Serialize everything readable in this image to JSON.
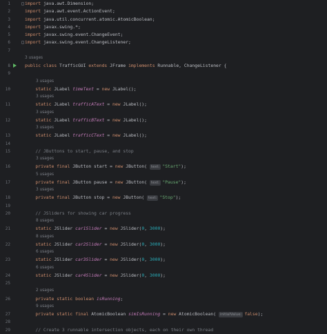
{
  "lines": [
    {
      "n": "1",
      "html": "<span class='kw'>import</span> java.awt.Dimension;"
    },
    {
      "n": "2",
      "html": "<span class='kw'>import</span> java.awt.event.ActionEvent;"
    },
    {
      "n": "3",
      "html": "<span class='kw'>import</span> java.util.concurrent.atomic.AtomicBoolean;"
    },
    {
      "n": "4",
      "html": "<span class='kw'>import</span> javax.swing.*;"
    },
    {
      "n": "5",
      "html": "<span class='kw'>import</span> javax.swing.event.ChangeEvent;"
    },
    {
      "n": "6",
      "html": "<span class='kw'>import</span> javax.swing.event.ChangeListener;"
    },
    {
      "n": "7",
      "html": ""
    },
    {
      "usage": "3 usages"
    },
    {
      "n": "8",
      "run": true,
      "html": "<span class='kw'>public class</span> TrafficGUI <span class='kw'>extends</span> JFrame <span class='kw'>implements</span> Runnable, ChangeListener {"
    },
    {
      "n": "9",
      "html": ""
    },
    {
      "usage": "3 usages"
    },
    {
      "n": "10",
      "html": "    <span class='kw'>static</span> JLabel <span class='field'>timeText</span> = <span class='kw'>new</span> JLabel();"
    },
    {
      "usage": "3 usages"
    },
    {
      "n": "11",
      "html": "    <span class='kw'>static</span> JLabel <span class='field'>trafficAText</span> = <span class='kw'>new</span> JLabel();"
    },
    {
      "usage": "3 usages"
    },
    {
      "n": "12",
      "html": "    <span class='kw'>static</span> JLabel <span class='field'>trafficBText</span> = <span class='kw'>new</span> JLabel();"
    },
    {
      "usage": "3 usages"
    },
    {
      "n": "13",
      "html": "    <span class='kw'>static</span> JLabel <span class='field'>trafficCText</span> = <span class='kw'>new</span> JLabel();"
    },
    {
      "n": "14",
      "html": ""
    },
    {
      "n": "15",
      "html": "    <span class='cm'>// JButtons to start, pause, and stop</span>"
    },
    {
      "usage": "3 usages"
    },
    {
      "n": "16",
      "html": "    <span class='kw'>private final</span> JButton start = <span class='kw'>new</span> JButton( <span class='hint'>text:</span><span class='str'>\"Start\"</span>);"
    },
    {
      "usage": "5 usages"
    },
    {
      "n": "17",
      "html": "    <span class='kw'>private final</span> JButton pause = <span class='kw'>new</span> JButton( <span class='hint'>text:</span><span class='str'>\"Pause\"</span>);"
    },
    {
      "usage": "3 usages"
    },
    {
      "n": "18",
      "html": "    <span class='kw'>private final</span> JButton stop = <span class='kw'>new</span> JButton( <span class='hint'>text:</span><span class='str'>\"Stop\"</span>);"
    },
    {
      "n": "19",
      "html": ""
    },
    {
      "n": "20",
      "html": "    <span class='cm'>// JSliders for showing car progress</span>"
    },
    {
      "usage": "8 usages"
    },
    {
      "n": "21",
      "html": "    <span class='kw'>static</span> JSlider <span class='field'>car1Slider</span> = <span class='kw'>new</span> JSlider(<span class='num-lit'>0</span>, <span class='num-lit'>3000</span>);"
    },
    {
      "usage": "8 usages"
    },
    {
      "n": "22",
      "html": "    <span class='kw'>static</span> JSlider <span class='field'>car2Slider</span> = <span class='kw'>new</span> JSlider(<span class='num-lit'>0</span>, <span class='num-lit'>3000</span>);"
    },
    {
      "usage": "6 usages"
    },
    {
      "n": "23",
      "html": "    <span class='kw'>static</span> JSlider <span class='field'>car3Slider</span> = <span class='kw'>new</span> JSlider(<span class='num-lit'>0</span>, <span class='num-lit'>3000</span>);"
    },
    {
      "usage": "6 usages"
    },
    {
      "n": "24",
      "html": "    <span class='kw'>static</span> JSlider <span class='field'>car4Slider</span> = <span class='kw'>new</span> JSlider(<span class='num-lit'>0</span>, <span class='num-lit'>3000</span>);"
    },
    {
      "n": "25",
      "html": ""
    },
    {
      "usage": "2 usages"
    },
    {
      "n": "26",
      "html": "    <span class='kw'>private static boolean</span> <span class='field'>isRunning</span>;"
    },
    {
      "usage": "9 usages"
    },
    {
      "n": "27",
      "html": "    <span class='kw'>private static final</span> AtomicBoolean <span class='field'>simIsRunning</span> = <span class='kw'>new</span> AtomicBoolean( <span class='hint'>initialValue:</span><span class='kw'>false</span>);"
    },
    {
      "n": "28",
      "html": ""
    },
    {
      "n": "29",
      "html": "    <span class='cm'>// Create 3 runnable intersection objects, each on their own thread</span>"
    }
  ]
}
